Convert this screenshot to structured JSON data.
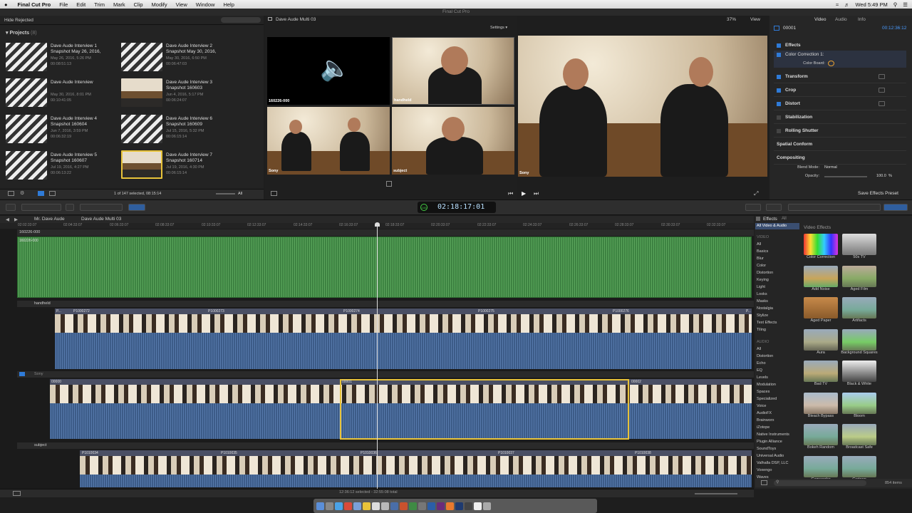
{
  "menubar": {
    "apple": "",
    "app": "Final Cut Pro",
    "items": [
      "File",
      "Edit",
      "Trim",
      "Mark",
      "Clip",
      "Modify",
      "View",
      "Window",
      "Help"
    ],
    "clock": "Wed 5:49 PM"
  },
  "window_title": "Final Cut Pro",
  "browser": {
    "filter": "Hide Rejected",
    "section": "Projects",
    "section_count": "(8)",
    "status": "1 of 147 selected, 08:15:14",
    "all_label": "All",
    "projects": [
      {
        "title": "Dave Aude Interview 1 Snapshot May 26, 2016,",
        "date": "May 26, 2016, 5:26 PM",
        "dur": "00:08:51:13"
      },
      {
        "title": "Dave Aude Interview 2 Snapshot May 30, 2016,",
        "date": "May 30, 2016, 6:50 PM",
        "dur": "00:06:47:03"
      },
      {
        "title": "Dave Aude Interview",
        "date": "May 30, 2016, 8:01 PM",
        "dur": "00:10:41:05"
      },
      {
        "title": "Dave Aude Interview 3 Snapshot 160603",
        "date": "Jun 4, 2016, 5:17 PM",
        "dur": "00:06:24:07"
      },
      {
        "title": "Dave Aude Interview 4 Snapshot 160604",
        "date": "Jun 7, 2016, 3:59 PM",
        "dur": "00:06:32:19"
      },
      {
        "title": "Dave Aude Interview 6 Snapshot 160609",
        "date": "Jul 15, 2016, 5:32 PM",
        "dur": "00:06:15:14"
      },
      {
        "title": "Dave Aude Interview 5 Snapshot 160607",
        "date": "Jul 19, 2016, 4:27 PM",
        "dur": "00:06:13:22"
      },
      {
        "title": "Dave Aude Interview 7 Snapshot 160714",
        "date": "Jul 19, 2016, 4:30 PM",
        "dur": "00:06:15:14"
      }
    ]
  },
  "angle_viewer": {
    "title": "Dave Aude Multi 03",
    "settings": "Settings",
    "angles": [
      "160226-000",
      "handheld",
      "Sony",
      "subject"
    ]
  },
  "viewer": {
    "zoom": "37%",
    "view": "View",
    "angle": "Sony"
  },
  "inspector": {
    "tabs": [
      "Video",
      "Audio",
      "Info"
    ],
    "clip": "00001",
    "tc": "00:12:36:12",
    "effects": "Effects",
    "cc": "Color Correction 1:",
    "color_board": "Color Board:",
    "transform": "Transform",
    "crop": "Crop",
    "distort": "Distort",
    "stabilization": "Stabilization",
    "rolling": "Rolling Shutter",
    "spatial": "Spatial Conform",
    "compositing": "Compositing",
    "blend_label": "Blend Mode:",
    "blend_value": "Normal",
    "opacity_label": "Opacity:",
    "opacity_value": "100.0",
    "opacity_unit": "%",
    "save_preset": "Save Effects Preset"
  },
  "timecode": {
    "main": "02:18:17:01",
    "rate": "100"
  },
  "timeline": {
    "breadcrumb_1": "Mr. Dave Aude",
    "breadcrumb_2": "Dave Aude Multi 03",
    "ruler": [
      "02:02:33:07",
      "02:04:33:07",
      "02:06:33:07",
      "02:08:33:07",
      "02:10:33:07",
      "02:12:33:07",
      "02:14:33:07",
      "02:16:33:07",
      "02:18:33:07",
      "02:20:33:07",
      "02:22:33:07",
      "02:24:33:07",
      "02:26:33:07",
      "02:28:33:07",
      "02:30:33:07",
      "02:32:33:07"
    ],
    "lane_names": [
      "160226-000",
      "handheld",
      "Sony",
      "subject"
    ],
    "green_clip": "160226-000",
    "handheld_clips": [
      "P...",
      "P1000272",
      "P1000273",
      "P1000274",
      "P1000275",
      "P1000276",
      "P..."
    ],
    "sony_clips": [
      "00000",
      "00001",
      "00002"
    ],
    "subject_clips": [
      "P1010034",
      "P1010035",
      "P1010036",
      "P1010037",
      "P1010038"
    ],
    "status": "12:36:12 selected - 32:55:08 total"
  },
  "effects_browser": {
    "title": "Effects",
    "all": "All",
    "all_va": "All Video & Audio",
    "header": "Video Effects",
    "count": "854 items",
    "video_section": "VIDEO",
    "audio_section": "AUDIO",
    "video_cats": [
      "All",
      "Basics",
      "Blur",
      "Color",
      "Distortion",
      "Keying",
      "Light",
      "Looks",
      "Masks",
      "Nostalgia",
      "Stylize",
      "Text Effects",
      "Tiling"
    ],
    "audio_cats": [
      "All",
      "Distortion",
      "Echo",
      "EQ",
      "Levels",
      "Modulation",
      "Spaces",
      "Specialized",
      "Voice",
      "AudioFX",
      "Brainworx",
      "iZotope",
      "Native Instruments",
      "Plugin Alliance",
      "SoundToys",
      "Universal Audio",
      "Valhalla DSP, LLC",
      "Voxengo",
      "Waves"
    ],
    "items": [
      "Color Correction",
      "50s TV",
      "Add Noise",
      "Aged Film",
      "Aged Paper",
      "Artifacts",
      "Aura",
      "Background Squares",
      "Bad TV",
      "Black & White",
      "Bleach Bypass",
      "Bloom",
      "Bokeh Random",
      "Broadcast Safe",
      "Camcorder",
      "Cartoon"
    ]
  }
}
